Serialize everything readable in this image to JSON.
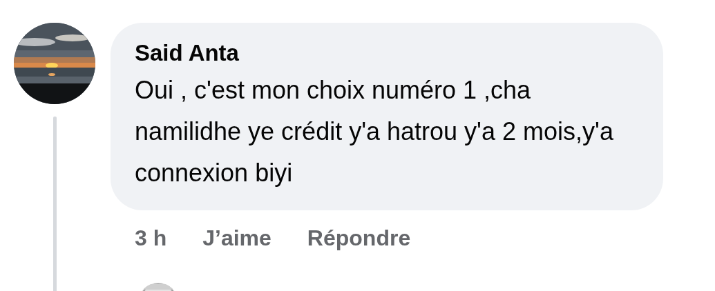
{
  "comment": {
    "author": "Said Anta",
    "text": "Oui , c'est mon choix numéro 1 ,cha namilidhe ye crédit y'a hatrou y'a 2 mois,y'a connexion biyi",
    "time": "3 h",
    "actions": [
      "J’aime",
      "Répondre"
    ]
  }
}
